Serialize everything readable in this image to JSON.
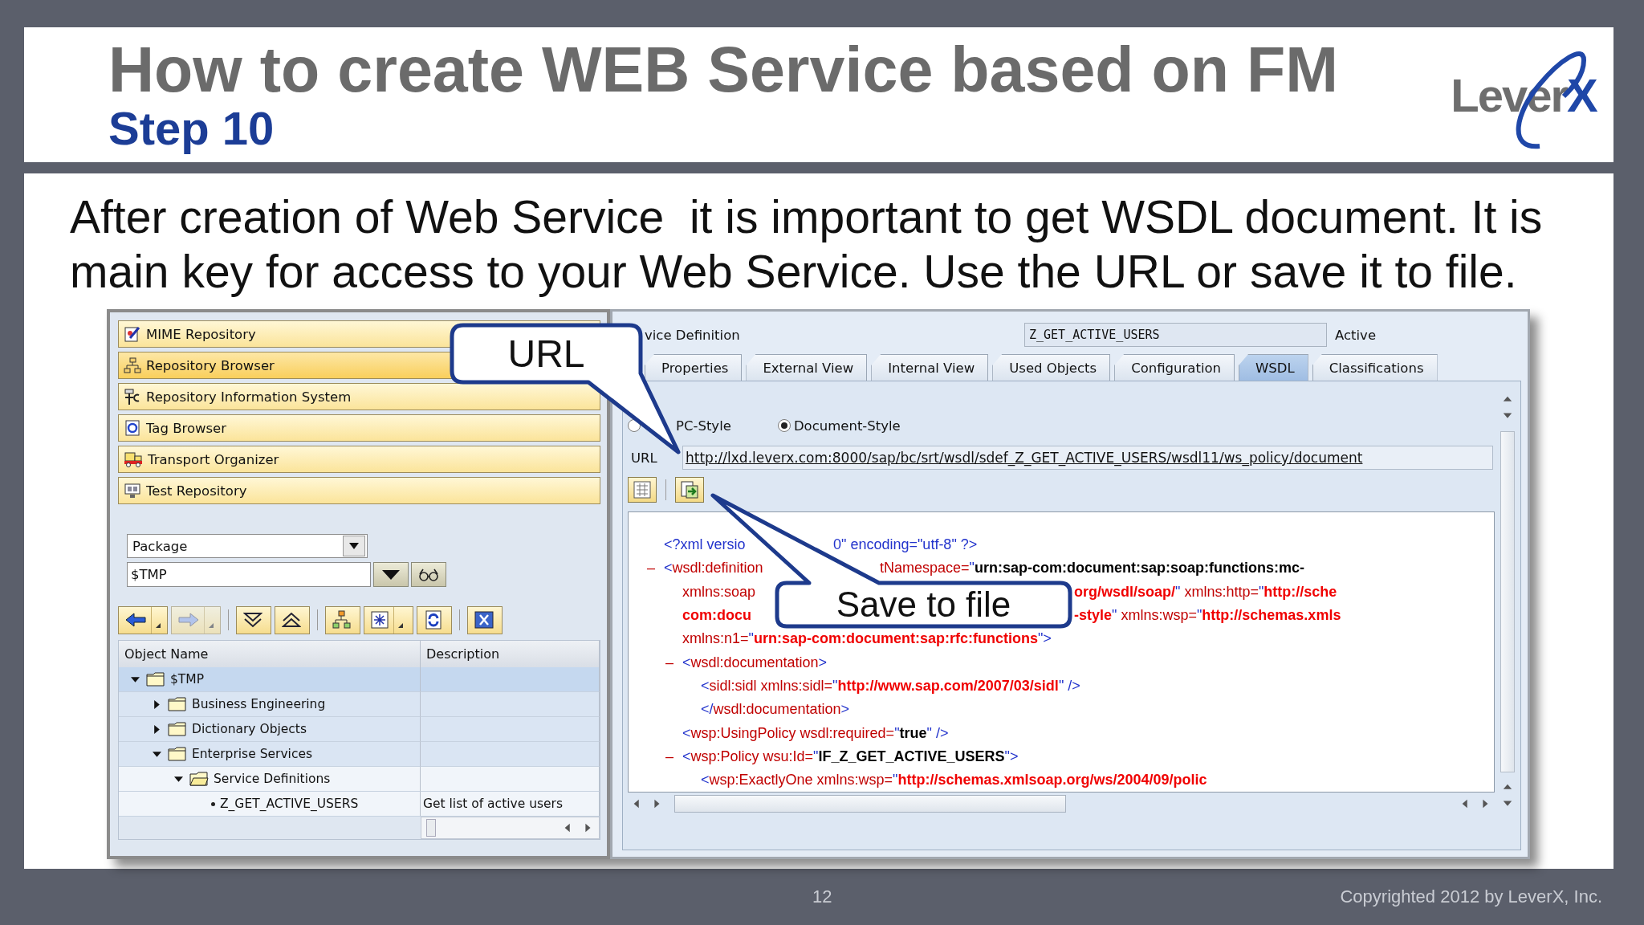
{
  "header": {
    "title": "How to create WEB Service based on FM",
    "subtitle": "Step 10",
    "logo": {
      "text": "Lever",
      "accent": "X"
    }
  },
  "intro": "After creation of Web Service  it is important to get WSDL document. It is main key for access to your Web Service. Use the URL or save it to file.",
  "nav": [
    {
      "label": "MIME Repository",
      "kind": "mime",
      "selected": false
    },
    {
      "label": "Repository Browser",
      "kind": "browser",
      "selected": true
    },
    {
      "label": "Repository Information System",
      "kind": "info",
      "selected": false
    },
    {
      "label": "Tag Browser",
      "kind": "tag",
      "selected": false
    },
    {
      "label": "Transport Organizer",
      "kind": "transport",
      "selected": false
    },
    {
      "label": "Test Repository",
      "kind": "test",
      "selected": false
    }
  ],
  "object_list": {
    "type": "Package",
    "name": "$TMP"
  },
  "toolbar": [
    [
      {
        "kind": "back",
        "disabled": false,
        "menu": true
      },
      {
        "kind": "forward",
        "disabled": true,
        "menu": true
      }
    ],
    [
      {
        "kind": "expand",
        "disabled": false,
        "menu": false
      },
      {
        "kind": "collapse",
        "disabled": false,
        "menu": false
      }
    ],
    [
      {
        "kind": "hierarchy",
        "disabled": false,
        "menu": false
      },
      {
        "kind": "asterisk",
        "disabled": false,
        "menu": true
      },
      {
        "kind": "refresh",
        "disabled": false,
        "menu": false
      }
    ],
    [
      {
        "kind": "close",
        "disabled": false,
        "menu": false
      }
    ]
  ],
  "tree": {
    "columns": [
      "Object Name",
      "Description"
    ],
    "rows": [
      {
        "name": "$TMP",
        "kind": "folder",
        "selected": true,
        "expanded": true,
        "children": [
          {
            "name": "Business Engineering",
            "kind": "folder",
            "selected": false,
            "expanded": false
          },
          {
            "name": "Dictionary Objects",
            "kind": "folder",
            "selected": false,
            "expanded": false
          },
          {
            "name": "Enterprise Services",
            "kind": "folder",
            "selected": false,
            "expanded": true,
            "children": [
              {
                "name": "Service Definitions",
                "kind": "open-folder",
                "selected": false,
                "expanded": true,
                "children": [
                  {
                    "name": "Z_GET_ACTIVE_USERS",
                    "kind": "leaf",
                    "selected": false,
                    "description": "Get list of active users"
                  }
                ]
              }
            ]
          }
        ]
      }
    ]
  },
  "service": {
    "label": "vice Definition",
    "name": "Z_GET_ACTIVE_USERS",
    "status": "Active"
  },
  "tabs": [
    {
      "label": "Properties",
      "selected": false
    },
    {
      "label": "External View",
      "selected": false
    },
    {
      "label": "Internal View",
      "selected": false
    },
    {
      "label": "Used Objects",
      "selected": false
    },
    {
      "label": "Configuration",
      "selected": false
    },
    {
      "label": "WSDL",
      "selected": true
    },
    {
      "label": "Classifications",
      "selected": false
    }
  ],
  "wsdl": {
    "styles": [
      {
        "label": "PC-Style",
        "selected": false
      },
      {
        "label": "Document-Style",
        "selected": true
      }
    ],
    "url_label": "URL",
    "url": "http://lxd.leverx.com:8000/sap/bc/srt/wsdl/sdef_Z_GET_ACTIVE_USERS/wsdl11/ws_policy/document"
  },
  "xml": [
    {
      "line": {
        "before": [
          {
            "text": "<?xml versio",
            "kind": "mark"
          }
        ],
        "after": [
          {
            "text": "0\" encoding=\"utf-8\" ?>",
            "kind": "mark"
          }
        ]
      }
    },
    {
      "toggle": "–",
      "line": {
        "before": [
          {
            "text": "<",
            "kind": "mark"
          },
          {
            "text": "wsdl:definition",
            "kind": "name"
          }
        ],
        "after": [
          {
            "text": "tNamespace=",
            "kind": "name"
          },
          {
            "text": "\"",
            "kind": "mark"
          },
          {
            "text": "urn:sap-com:document:sap:soap:functions:mc-",
            "kind": "strong"
          }
        ]
      },
      "more": [
        {
          "before": [
            {
              "text": "xmlns:soap",
              "kind": "name"
            }
          ],
          "after": [
            {
              "text": "org/wsdl/soap/",
              "kind": "value"
            },
            {
              "text": "\"",
              "kind": "mark"
            },
            {
              "text": " xmlns:http=",
              "kind": "name"
            },
            {
              "text": "\"",
              "kind": "mark"
            },
            {
              "text": "http://sche",
              "kind": "value"
            }
          ]
        },
        {
          "before": [
            {
              "text": "com:docu",
              "kind": "value"
            }
          ],
          "after": [
            {
              "text": "-style",
              "kind": "value"
            },
            {
              "text": "\"",
              "kind": "mark"
            },
            {
              "text": " xmlns:wsp=",
              "kind": "name"
            },
            {
              "text": "\"",
              "kind": "mark"
            },
            {
              "text": "http://schemas.xmls",
              "kind": "value"
            }
          ]
        },
        {
          "text": [
            {
              "text": "xmlns:n1=",
              "kind": "name"
            },
            {
              "text": "\"",
              "kind": "mark"
            },
            {
              "text": "urn:sap-com:document:sap:rfc:functions",
              "kind": "value"
            },
            {
              "text": "\">",
              "kind": "mark"
            }
          ]
        }
      ],
      "children": [
        {
          "toggle": "–",
          "line": {
            "text": [
              {
                "text": "<",
                "kind": "mark"
              },
              {
                "text": "wsdl:documentation",
                "kind": "name"
              },
              {
                "text": ">",
                "kind": "mark"
              }
            ]
          },
          "children": [
            {
              "line": {
                "text": [
                  {
                    "text": "<",
                    "kind": "mark"
                  },
                  {
                    "text": "sidl:sidl xmlns:sidl=",
                    "kind": "name"
                  },
                  {
                    "text": "\"",
                    "kind": "mark"
                  },
                  {
                    "text": "http://www.sap.com/2007/03/sidl",
                    "kind": "value"
                  },
                  {
                    "text": "\" />",
                    "kind": "mark"
                  }
                ]
              }
            }
          ],
          "close": {
            "text": [
              {
                "text": "</",
                "kind": "mark"
              },
              {
                "text": "wsdl:documentation",
                "kind": "name"
              },
              {
                "text": ">",
                "kind": "mark"
              }
            ]
          }
        },
        {
          "line": {
            "text": [
              {
                "text": "<",
                "kind": "mark"
              },
              {
                "text": "wsp:UsingPolicy wsdl:required=",
                "kind": "name"
              },
              {
                "text": "\"",
                "kind": "mark"
              },
              {
                "text": "true",
                "kind": "strong"
              },
              {
                "text": "\" />",
                "kind": "mark"
              }
            ]
          }
        },
        {
          "toggle": "–",
          "line": {
            "text": [
              {
                "text": "<",
                "kind": "mark"
              },
              {
                "text": "wsp:Policy wsu:Id=",
                "kind": "name"
              },
              {
                "text": "\"",
                "kind": "mark"
              },
              {
                "text": "IF_Z_GET_ACTIVE_USERS",
                "kind": "strong"
              },
              {
                "text": "\">",
                "kind": "mark"
              }
            ]
          },
          "children": [
            {
              "line": {
                "text": [
                  {
                    "text": "<",
                    "kind": "mark"
                  },
                  {
                    "text": "wsp:ExactlyOne xmlns:wsp=",
                    "kind": "name"
                  },
                  {
                    "text": "\"",
                    "kind": "mark"
                  },
                  {
                    "text": "http://schemas.xmlsoap.org/ws/2004/09/polic",
                    "kind": "value"
                  }
                ]
              }
            }
          ]
        }
      ]
    }
  ],
  "callouts": [
    {
      "text": "URL"
    },
    {
      "text": "Save to file"
    }
  ],
  "footer": {
    "page": "12",
    "copyright": "Copyrighted 2012 by LeverX, Inc."
  }
}
